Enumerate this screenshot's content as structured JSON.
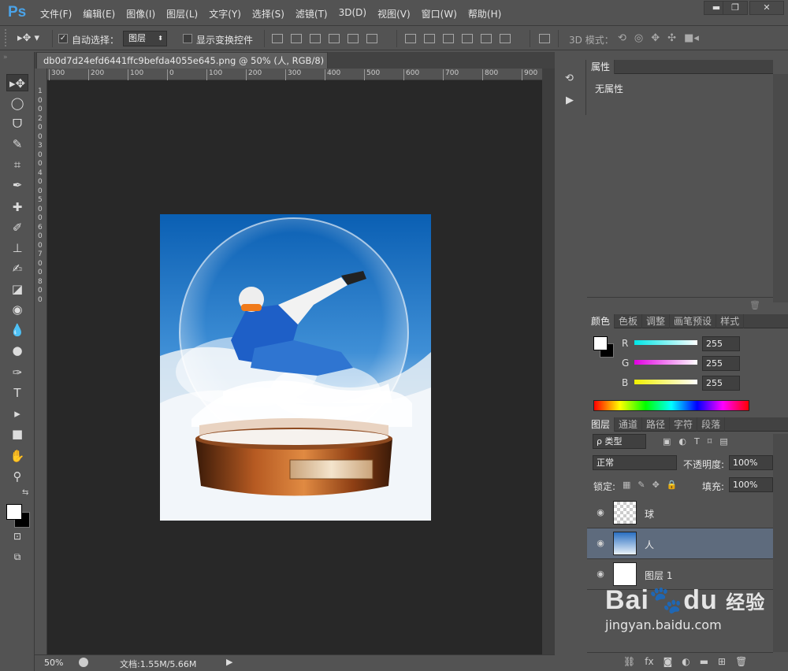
{
  "app": {
    "logo": "Ps"
  },
  "menu": {
    "items": [
      "文件(F)",
      "编辑(E)",
      "图像(I)",
      "图层(L)",
      "文字(Y)",
      "选择(S)",
      "滤镜(T)",
      "3D(D)",
      "视图(V)",
      "窗口(W)",
      "帮助(H)"
    ]
  },
  "window": {
    "minimize": "▬",
    "restore": "❐",
    "close": "✕"
  },
  "options": {
    "auto_select_label": "自动选择：",
    "auto_select_target": "图层",
    "show_transform_label": "显示变换控件",
    "mode_3d_label": "3D 模式："
  },
  "document": {
    "tab_title": "db0d7d24efd6441ffc9befda4055e645.png @ 50% (人, RGB/8) *",
    "tab_close": "×"
  },
  "rulers": {
    "top": [
      "300",
      "200",
      "100",
      "0",
      "100",
      "200",
      "300",
      "400",
      "500",
      "600",
      "700",
      "800",
      "900"
    ],
    "left": [
      "1",
      "0",
      "0",
      "2",
      "0",
      "0",
      "3",
      "0",
      "0",
      "4",
      "0",
      "0",
      "5",
      "0",
      "0",
      "6",
      "0",
      "0",
      "7",
      "0",
      "0",
      "8",
      "0",
      "0"
    ]
  },
  "status": {
    "zoom": "50%",
    "doc_info": "文档:1.55M/5.66M"
  },
  "properties": {
    "tab": "属性",
    "empty_text": "无属性"
  },
  "color_panel": {
    "tabs": [
      "颜色",
      "色板",
      "调整",
      "画笔预设",
      "样式"
    ],
    "channels": [
      {
        "name": "R",
        "value": "255",
        "color": "#00e5e5"
      },
      {
        "name": "G",
        "value": "255",
        "color": "#e000e0"
      },
      {
        "name": "B",
        "value": "255",
        "color": "#f0f000"
      }
    ]
  },
  "layers_panel": {
    "tabs": [
      "图层",
      "通道",
      "路径",
      "字符",
      "段落"
    ],
    "filter_label": "ρ 类型",
    "blend_mode": "正常",
    "opacity_label": "不透明度:",
    "opacity_value": "100%",
    "lock_label": "锁定:",
    "fill_label": "填充:",
    "fill_value": "100%",
    "layers": [
      {
        "name": "球",
        "selected": false
      },
      {
        "name": "人",
        "selected": true
      },
      {
        "name": "图层 1",
        "selected": false
      }
    ]
  },
  "watermark": {
    "brand": "Bai",
    "brand2": "du",
    "cn": "经验",
    "url": "jingyan.baidu.com"
  }
}
